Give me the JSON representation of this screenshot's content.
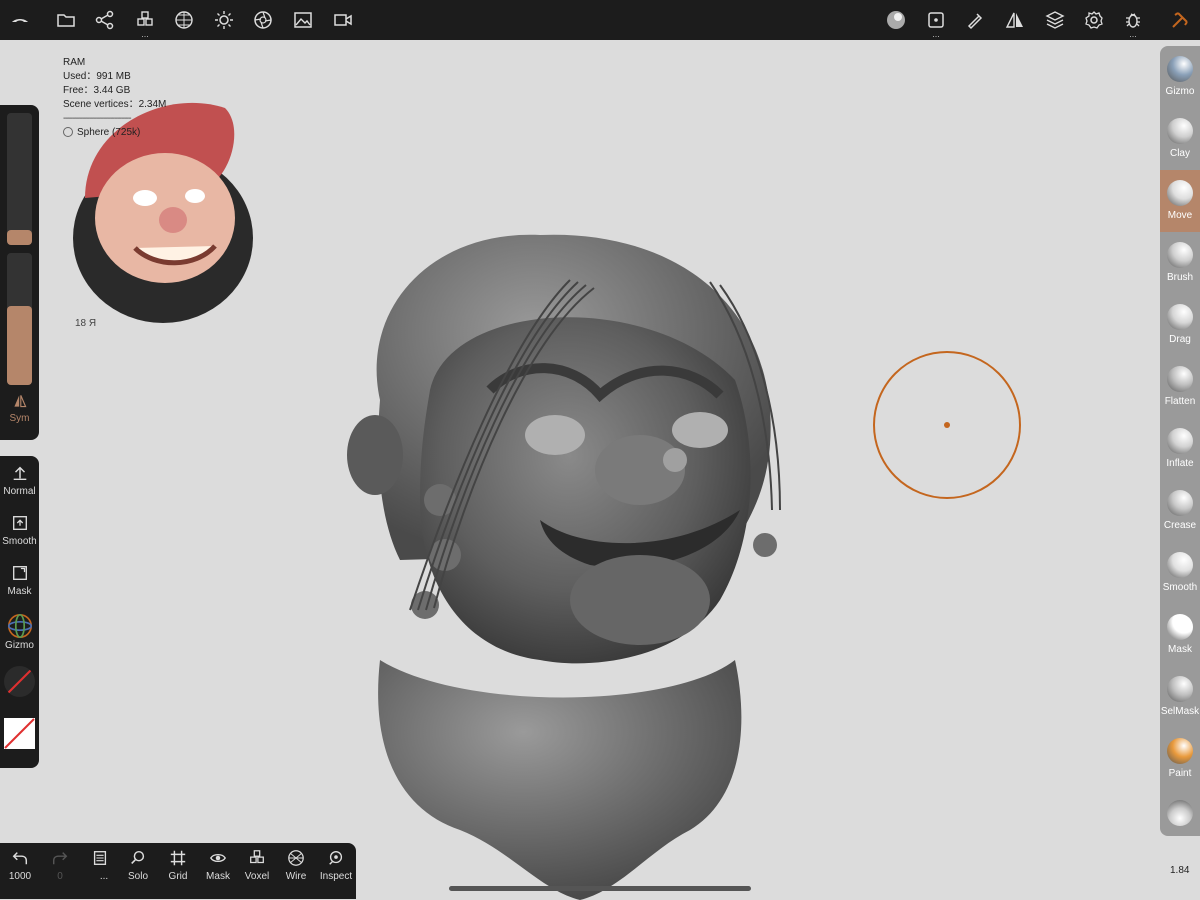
{
  "topbar": {
    "left_icons": [
      "logo-icon",
      "folder-icon",
      "share-icon",
      "voxel-cubes-icon",
      "grid-sphere-icon",
      "light-icon",
      "aperture-icon",
      "image-icon",
      "video-icon"
    ],
    "right_icons": [
      "matcap-icon",
      "interaction-icon",
      "pen-icon",
      "symmetry-icon",
      "layers-icon",
      "settings-icon",
      "debug-icon",
      "tools-icon"
    ],
    "dots": "..."
  },
  "stats": {
    "ram": "RAM",
    "used": "Used：991 MB",
    "free": "Free：3.44 GB",
    "vertices": "Scene vertices：2.34M",
    "separator": "-----------------------------",
    "object": "Sphere (725k)"
  },
  "reference": {
    "signature": "18 Я"
  },
  "left_slider": {
    "radius_fraction": 0.11,
    "intensity_fraction": 0.6,
    "sym_label": "Sym"
  },
  "left_tools": [
    {
      "label": "Normal",
      "icon": "arrow-up-icon"
    },
    {
      "label": "Smooth",
      "icon": "smooth-box-icon"
    },
    {
      "label": "Mask",
      "icon": "mask-box-icon"
    },
    {
      "label": "Gizmo",
      "icon": "gizmo-icon"
    }
  ],
  "right_tools": [
    {
      "label": "Gizmo",
      "color": "#8aa0b8"
    },
    {
      "label": "Clay",
      "color": "#cfcfcf"
    },
    {
      "label": "Move",
      "color": "#dedede",
      "active": true
    },
    {
      "label": "Brush",
      "color": "#cfcfcf"
    },
    {
      "label": "Drag",
      "color": "#d6d6d6"
    },
    {
      "label": "Flatten",
      "color": "#bfbfbf"
    },
    {
      "label": "Inflate",
      "color": "#d2d2d2"
    },
    {
      "label": "Crease",
      "color": "#c8c8c8"
    },
    {
      "label": "Smooth",
      "color": "#e0e0e0"
    },
    {
      "label": "Mask",
      "color": "#ffffff"
    },
    {
      "label": "SelMask",
      "color": "#c0c0c0"
    },
    {
      "label": "Paint",
      "color": "#e99a3c"
    }
  ],
  "bottom_tools": [
    {
      "label": "1000",
      "icon": "undo-icon"
    },
    {
      "label": "0",
      "icon": "redo-icon"
    },
    {
      "label": "...",
      "icon": "scene-icon"
    },
    {
      "label": "Solo",
      "icon": "search-icon"
    },
    {
      "label": "Grid",
      "icon": "grid-icon"
    },
    {
      "label": "Mask",
      "icon": "eye-icon"
    },
    {
      "label": "Voxel",
      "icon": "voxel-icon"
    },
    {
      "label": "Wire",
      "icon": "wire-icon"
    },
    {
      "label": "Inspect",
      "icon": "inspect-icon"
    }
  ],
  "zoom": "1.84",
  "colors": {
    "accent": "#b5866a",
    "brush_cursor": "#c4661e",
    "viewport_bg": "#dcdcdc",
    "toolbar_bg": "#1c1c1c"
  }
}
